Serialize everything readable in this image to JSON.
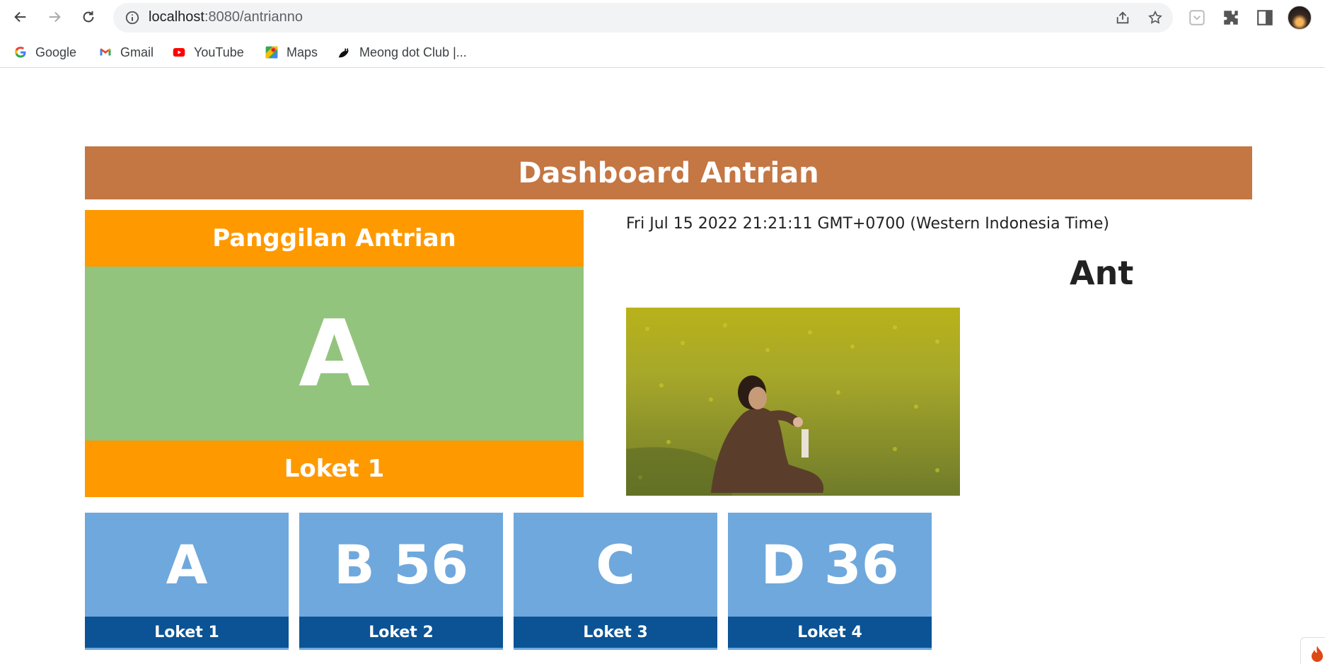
{
  "browser": {
    "url_host": "localhost",
    "url_rest": ":8080/antrianno",
    "bookmarks": [
      {
        "label": "Google",
        "icon": "google-icon"
      },
      {
        "label": "Gmail",
        "icon": "gmail-icon"
      },
      {
        "label": "YouTube",
        "icon": "youtube-icon"
      },
      {
        "label": "Maps",
        "icon": "maps-icon"
      },
      {
        "label": "Meong dot Club |...",
        "icon": "cat-icon"
      }
    ]
  },
  "dashboard": {
    "title": "Dashboard Antrian",
    "call": {
      "header": "Panggilan Antrian",
      "number": "A",
      "counter": "Loket 1"
    },
    "datetime": "Fri Jul 15 2022 21:21:11 GMT+0700 (Western Indonesia Time)",
    "marquee": "Ant",
    "counters": [
      {
        "number": "A",
        "label": "Loket 1"
      },
      {
        "number": "B 56",
        "label": "Loket 2"
      },
      {
        "number": "C",
        "label": "Loket 3"
      },
      {
        "number": "D 36",
        "label": "Loket 4"
      }
    ]
  },
  "colors": {
    "title_bar": "#c47643",
    "call_header": "#ff9900",
    "call_body": "#93c47d",
    "counter_number": "#6fa8dc",
    "counter_label": "#0b5394"
  }
}
